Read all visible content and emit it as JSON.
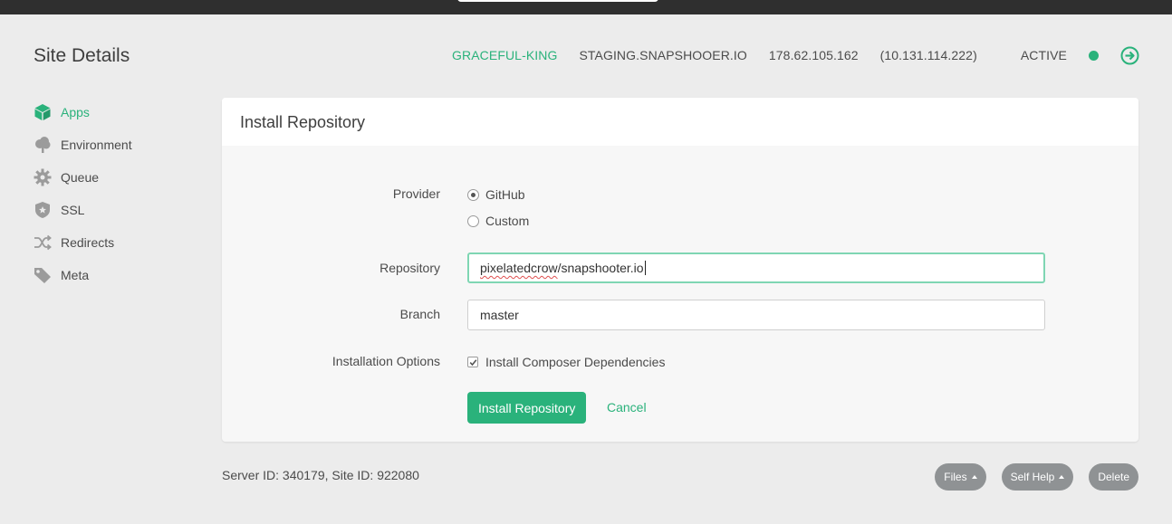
{
  "page": {
    "title": "Site Details"
  },
  "server": {
    "name": "GRACEFUL-KING",
    "domain": "STAGING.SNAPSHOOER.IO",
    "public_ip": "178.62.105.162",
    "private_ip": "(10.131.114.222)",
    "status": "ACTIVE",
    "status_color": "#2ab27b",
    "goto_icon": "arrow-circle-right-icon"
  },
  "sidebar": {
    "items": [
      {
        "label": "Apps",
        "icon": "cube-icon",
        "active": true
      },
      {
        "label": "Environment",
        "icon": "tree-icon",
        "active": false
      },
      {
        "label": "Queue",
        "icon": "gear-icon",
        "active": false
      },
      {
        "label": "SSL",
        "icon": "shield-icon",
        "active": false
      },
      {
        "label": "Redirects",
        "icon": "shuffle-icon",
        "active": false
      },
      {
        "label": "Meta",
        "icon": "tag-icon",
        "active": false
      }
    ]
  },
  "panel": {
    "title": "Install Repository",
    "provider": {
      "label": "Provider",
      "options": [
        {
          "label": "GitHub",
          "selected": true
        },
        {
          "label": "Custom",
          "selected": false
        }
      ]
    },
    "repository": {
      "label": "Repository",
      "owner": "pixelatedcrow",
      "rest": "/snapshooter.io"
    },
    "branch": {
      "label": "Branch",
      "value": "master"
    },
    "options": {
      "label": "Installation Options",
      "composer_label": "Install Composer Dependencies",
      "composer_checked": true
    },
    "submit_label": "Install Repository",
    "cancel_label": "Cancel"
  },
  "footer": {
    "ids": "Server ID: 340179, Site ID: 922080",
    "files_label": "Files",
    "self_help_label": "Self Help",
    "delete_label": "Delete"
  },
  "colors": {
    "accent": "#2ab27b",
    "background": "#ececec",
    "pill": "#8f9294"
  }
}
